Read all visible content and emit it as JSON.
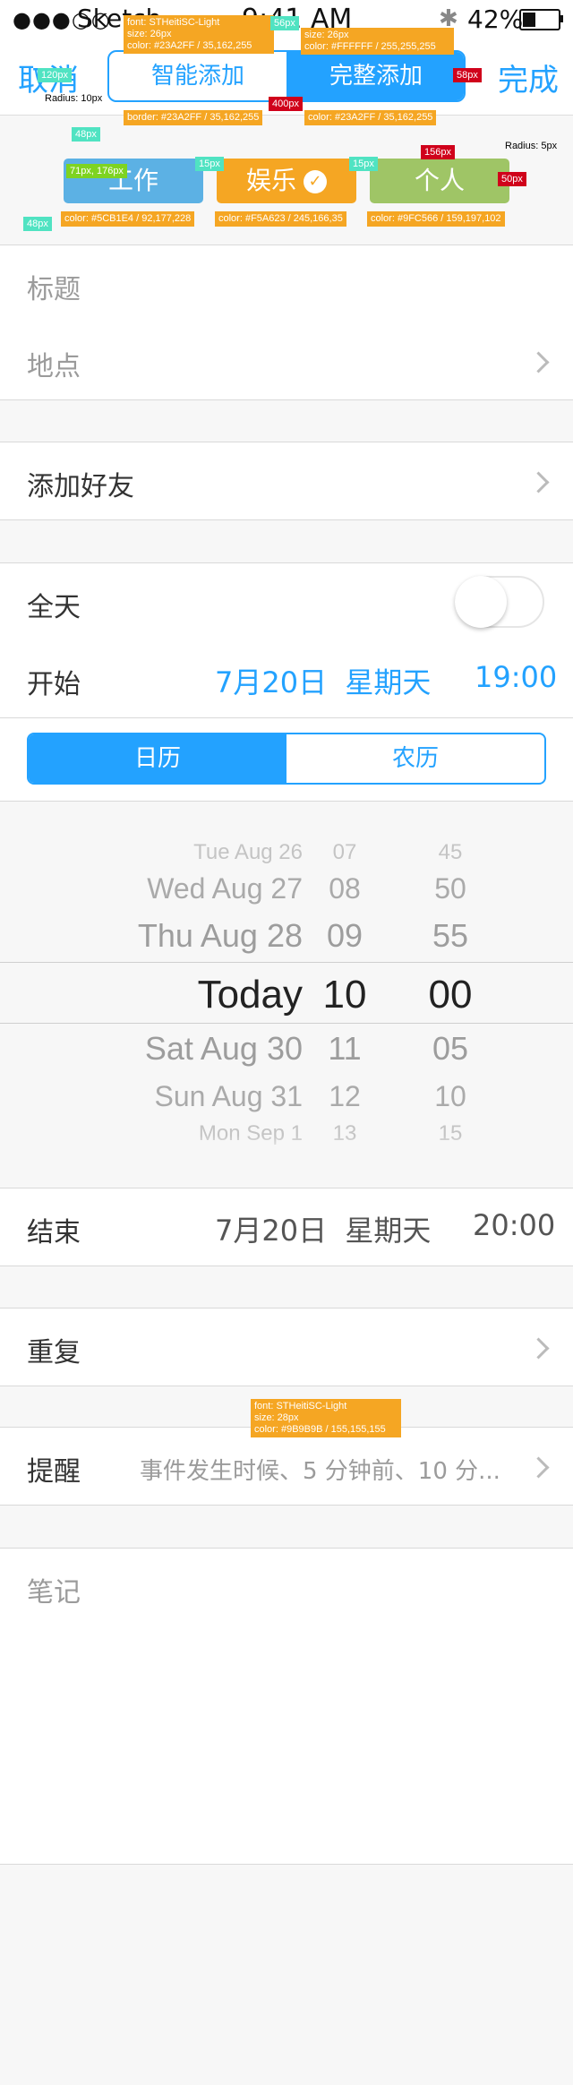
{
  "status_bar": {
    "signal": "●●●○○",
    "carrier": "Sketch",
    "time": "9:41 AM",
    "battery_pct": "42%"
  },
  "nav": {
    "cancel": "取消",
    "done": "完成",
    "seg_smart": "智能添加",
    "seg_full": "完整添加"
  },
  "categories": [
    {
      "label": "工作",
      "color": "#5CB1E4"
    },
    {
      "label": "娱乐",
      "color": "#F5A623"
    },
    {
      "label": "个人",
      "color": "#9FC566"
    }
  ],
  "form": {
    "title_placeholder": "标题",
    "location_placeholder": "地点",
    "add_friends": "添加好友",
    "all_day": "全天",
    "start_label": "开始",
    "start_date": "7月20日  星期天",
    "start_time": "19:00",
    "calendar_solar": "日历",
    "calendar_lunar": "农历",
    "end_label": "结束",
    "end_date": "7月20日  星期天",
    "end_time": "20:00",
    "repeat": "重复",
    "reminder": "提醒",
    "reminder_value": "事件发生时候、5 分钟前、10 分...",
    "notes_placeholder": "笔记"
  },
  "picker": {
    "rows": [
      {
        "date": "Tue Aug 26",
        "hour": "07",
        "min": "45"
      },
      {
        "date": "Wed Aug 27",
        "hour": "08",
        "min": "50"
      },
      {
        "date": "Thu Aug 28",
        "hour": "09",
        "min": "55"
      },
      {
        "date": "Today",
        "hour": "10",
        "min": "00"
      },
      {
        "date": "Sat Aug 30",
        "hour": "11",
        "min": "05"
      },
      {
        "date": "Sun Aug 31",
        "hour": "12",
        "min": "10"
      },
      {
        "date": "Mon Sep 1",
        "hour": "13",
        "min": "15"
      }
    ]
  },
  "annotations": {
    "smart_font": "font: STHeitiSC-Light",
    "smart_size": "size: 26px",
    "smart_color": "color: #23A2FF / 35,162,255",
    "full_size": "size: 26px",
    "full_color": "color: #FFFFFF / 255,255,255",
    "w56": "56px",
    "h58": "58px",
    "w120": "120px",
    "radius10": "Radius: 10px",
    "w400": "400px",
    "border": "border: #23A2FF / 35,162,255",
    "fill_color": "color: #23A2FF / 35,162,255",
    "h48a": "48px",
    "pos": "71px, 176px",
    "g15a": "15px",
    "g15b": "15px",
    "w156": "156px",
    "h50": "50px",
    "radius5": "Radius: 5px",
    "h48b": "48px",
    "c_work": "color: #5CB1E4 / 92,177,228",
    "c_fun": "color: #F5A623 / 245,166,35",
    "c_personal": "color: #9FC566 / 159,197,102",
    "rem_font": "font: STHeitiSC-Light",
    "rem_size": "size: 28px",
    "rem_color": "color: #9B9B9B / 155,155,155"
  }
}
